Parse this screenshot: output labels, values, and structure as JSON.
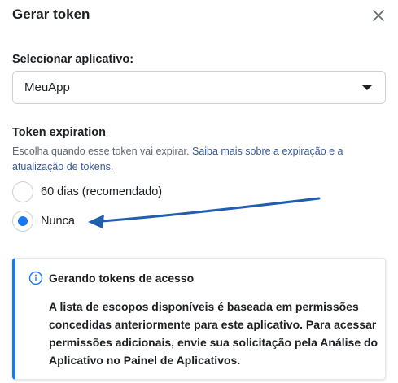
{
  "dialog": {
    "title": "Gerar token",
    "close_icon": "close-icon"
  },
  "app_select": {
    "label": "Selecionar aplicativo:",
    "value": "MeuApp",
    "caret_icon": "caret-down-icon"
  },
  "expiration": {
    "title": "Token expiration",
    "description": "Escolha quando esse token vai expirar. ",
    "link": "Saiba mais sobre a expiração e a atualização de tokens.",
    "options": [
      {
        "label": "60 dias (recomendado)",
        "checked": false
      },
      {
        "label": "Nunca",
        "checked": true
      }
    ]
  },
  "info": {
    "icon": "info-icon",
    "title": "Gerando tokens de acesso",
    "body": "A lista de escopos disponíveis é baseada em permissões concedidas anteriormente para este aplicativo. Para acessar permissões adicionais, envie sua solicitação pela Análise do Aplicativo no Painel de Aplicativos."
  },
  "colors": {
    "accent": "#1877f2",
    "link": "#385898",
    "annotation_arrow": "#1f5fae"
  }
}
